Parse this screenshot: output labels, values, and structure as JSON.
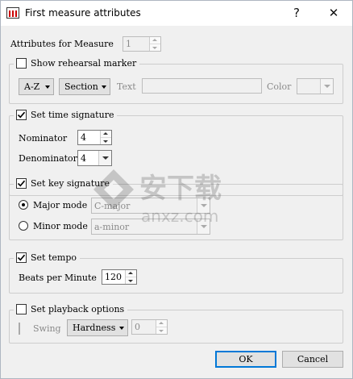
{
  "window": {
    "title": "First measure attributes",
    "help_glyph": "?",
    "close_glyph": "✕"
  },
  "measure": {
    "label": "Attributes for Measure",
    "value": "1"
  },
  "rehearsal": {
    "legend": "Show rehearsal marker",
    "checked": false,
    "style_button": "A-Z",
    "type_button": "Section",
    "text_label": "Text",
    "text_value": "",
    "color_label": "Color",
    "color_value": ""
  },
  "time_signature": {
    "legend": "Set time signature",
    "checked": true,
    "nominator_label": "Nominator",
    "nominator_value": "4",
    "denominator_label": "Denominator",
    "denominator_value": "4"
  },
  "key_signature": {
    "legend": "Set key signature",
    "checked": true,
    "major_label": "Major mode",
    "major_value": "C-major",
    "minor_label": "Minor mode",
    "minor_value": "a-minor",
    "selected_mode": "major"
  },
  "tempo": {
    "legend": "Set tempo",
    "checked": true,
    "bpm_label": "Beats per Minute",
    "bpm_value": "120"
  },
  "playback": {
    "legend": "Set playback options",
    "checked": false,
    "swing_label": "Swing",
    "hardness_button": "Hardness",
    "hardness_value": "0"
  },
  "buttons": {
    "ok": "OK",
    "cancel": "Cancel"
  },
  "watermark": {
    "brand_cn": "安下载",
    "brand_en": "anxz.com"
  },
  "colors": {
    "accent_focus": "#0078d7",
    "group_border": "#cdcdcd",
    "dialog_bg": "#f0f0f0"
  }
}
